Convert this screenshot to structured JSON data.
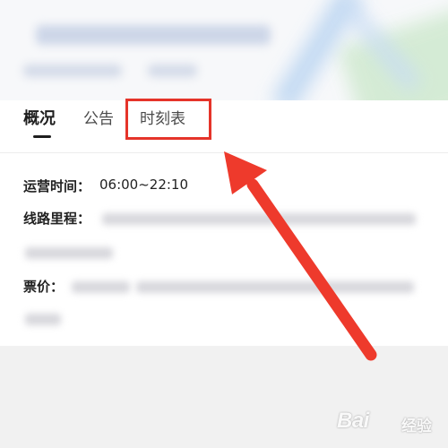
{
  "tabs": [
    {
      "label": "概况",
      "active": true
    },
    {
      "label": "公告",
      "active": false
    },
    {
      "label": "时刻表",
      "active": false
    }
  ],
  "info": {
    "hours_label": "运营时间：",
    "hours_value": "06:00~22:10",
    "length_label": "线路里程：",
    "fare_label": "票价："
  },
  "colors": {
    "highlight": "#e5342a",
    "arrow": "#ee3a2c"
  },
  "watermark": {
    "brand": "Bai",
    "suffix": "经验"
  }
}
